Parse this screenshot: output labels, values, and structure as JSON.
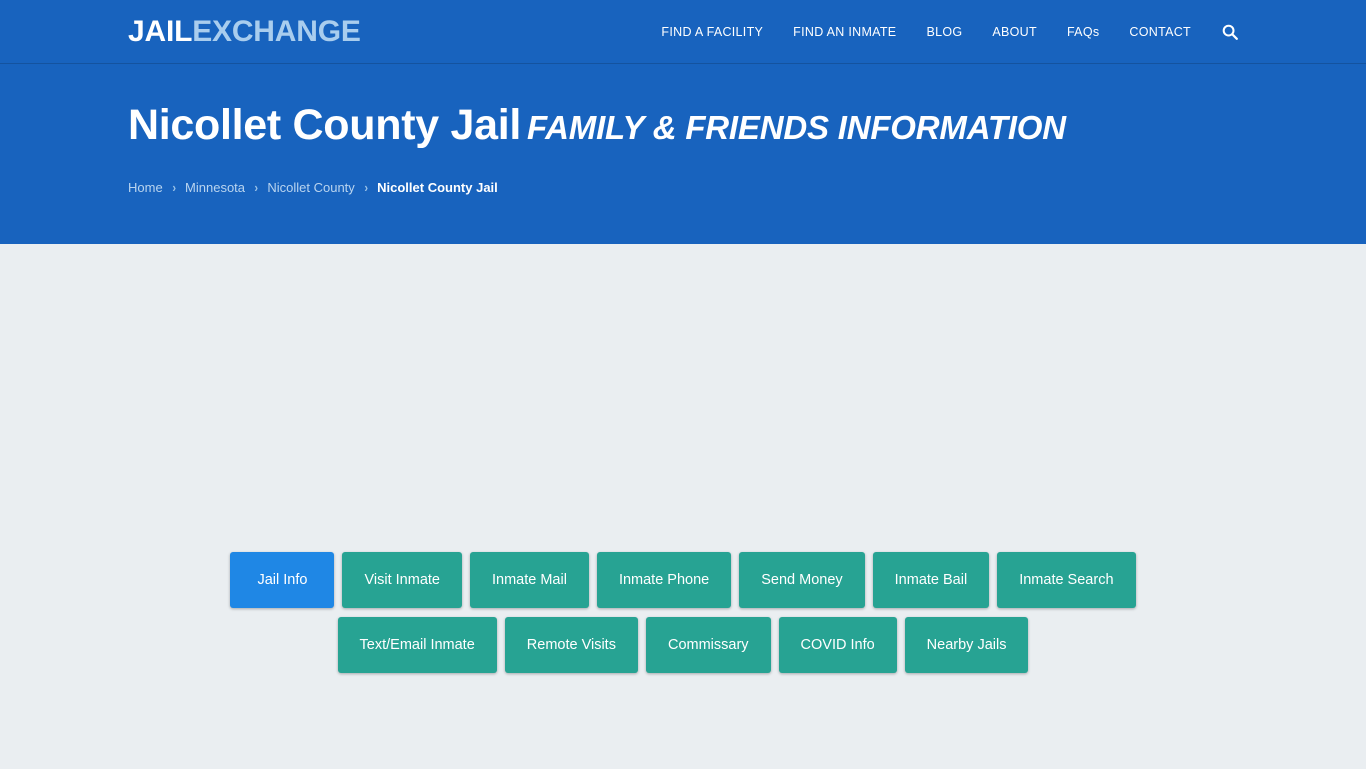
{
  "navbar": {
    "logo": {
      "part1": "JAIL",
      "part2": "EXCHANGE"
    },
    "links": [
      {
        "label": "FIND A FACILITY"
      },
      {
        "label": "FIND AN INMATE"
      },
      {
        "label": "BLOG"
      },
      {
        "label": "ABOUT"
      },
      {
        "label": "FAQs"
      },
      {
        "label": "CONTACT"
      }
    ],
    "search_icon": "search-icon"
  },
  "hero": {
    "title_main": "Nicollet County Jail",
    "title_sub": "FAMILY & FRIENDS INFORMATION",
    "breadcrumb": {
      "separator": "›",
      "items": [
        {
          "label": "Home",
          "active": false
        },
        {
          "label": "Minnesota",
          "active": false
        },
        {
          "label": "Nicollet County",
          "active": false
        },
        {
          "label": "Nicollet County Jail",
          "active": true
        }
      ]
    }
  },
  "main": {
    "buttons_row1": [
      {
        "label": "Jail Info",
        "active": true
      },
      {
        "label": "Visit Inmate",
        "active": false
      },
      {
        "label": "Inmate Mail",
        "active": false
      },
      {
        "label": "Inmate Phone",
        "active": false
      },
      {
        "label": "Send Money",
        "active": false
      },
      {
        "label": "Inmate Bail",
        "active": false
      },
      {
        "label": "Inmate Search",
        "active": false
      }
    ],
    "buttons_row2": [
      {
        "label": "Text/Email Inmate",
        "active": false
      },
      {
        "label": "Remote Visits",
        "active": false
      },
      {
        "label": "Commissary",
        "active": false
      },
      {
        "label": "COVID Info",
        "active": false
      },
      {
        "label": "Nearby Jails",
        "active": false
      }
    ]
  },
  "colors": {
    "brand_blue": "#1863be",
    "nav_border": "#14539f",
    "teal_button": "#27a393",
    "active_button": "#1f87e5",
    "page_background": "#eaeef1",
    "logo_accent": "#a9cdee",
    "breadcrumb_link": "#b9d4ef"
  }
}
